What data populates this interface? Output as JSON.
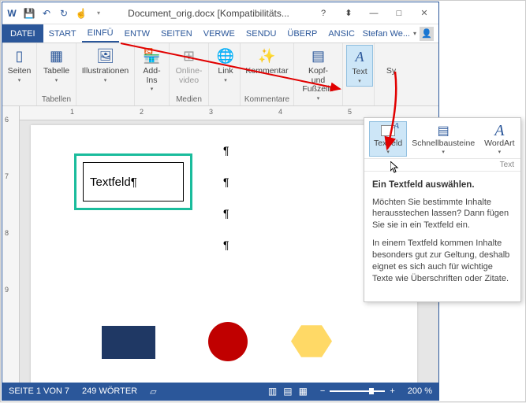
{
  "titlebar": {
    "title": "Document_orig.docx [Kompatibilitäts..."
  },
  "tabs": {
    "file": "DATEI",
    "start": "START",
    "einfu": "EINFÜ",
    "entw": "ENTW",
    "seiten": "SEITEN",
    "verwe": "VERWE",
    "sendu": "SENDU",
    "uberp": "ÜBERP",
    "ansic": "ANSIC"
  },
  "user": {
    "name": "Stefan We..."
  },
  "ribbon": {
    "seiten": {
      "label": "Seiten"
    },
    "tabelle": {
      "btn": "Tabelle",
      "group": "Tabellen"
    },
    "illustrationen": {
      "btn": "Illustrationen"
    },
    "addins": {
      "btn": "Add-Ins"
    },
    "video": {
      "btn": "Online-\nvideo",
      "group": "Medien"
    },
    "link": {
      "btn": "Link"
    },
    "kommentar": {
      "btn": "Kommentar",
      "group": "Kommentare"
    },
    "kopf": {
      "btn": "Kopf- und\nFußzeile"
    },
    "text": {
      "btn": "Text"
    },
    "sym": {
      "btn": "Sy"
    }
  },
  "dropdown": {
    "textfeld": "Textfeld",
    "schnell": "Schnellbausteine",
    "wordart": "WordArt",
    "grouplabel": "Text",
    "tt_title": "Ein Textfeld auswählen.",
    "tt_p1": "Möchten Sie bestimmte Inhalte herausstechen lassen? Dann fügen Sie sie in ein Textfeld ein.",
    "tt_p2": "In einem Textfeld kommen Inhalte besonders gut zur Geltung, deshalb eignet es sich auch für wichtige Texte wie Überschriften oder Zitate."
  },
  "doc": {
    "textbox_content": "Textfeld¶"
  },
  "ruler_h": {
    "t1": "1",
    "t2": "2",
    "t3": "3",
    "t4": "4",
    "t5": "5"
  },
  "ruler_v": {
    "t6": "6",
    "t7": "7",
    "t8": "8",
    "t9": "9"
  },
  "status": {
    "page": "SEITE 1 VON 7",
    "words": "249 WÖRTER",
    "zoom": "200 %",
    "minus": "−",
    "plus": "+"
  }
}
